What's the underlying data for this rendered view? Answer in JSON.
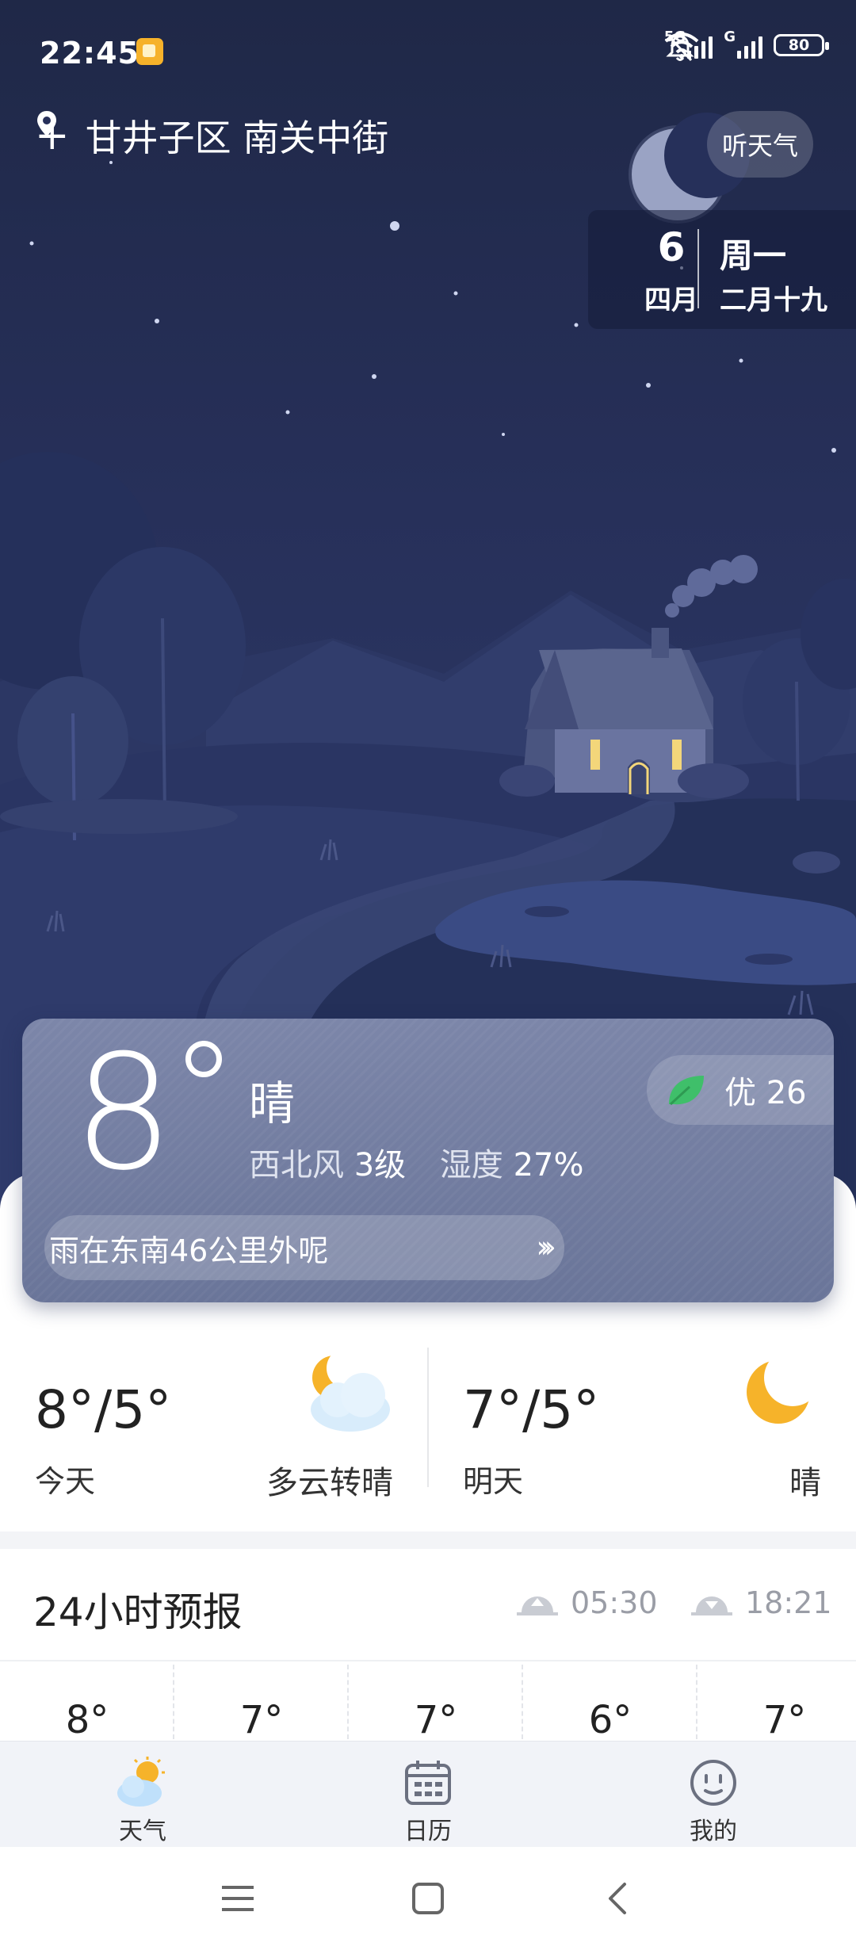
{
  "status_bar": {
    "time": "22:45",
    "network_1": "5G",
    "network_2": "G",
    "battery": "80"
  },
  "header": {
    "location": "甘井子区 南关中街",
    "listen_button": "听天气"
  },
  "date": {
    "day": "6",
    "month": "四月",
    "weekday": "周一",
    "lunar": "二月十九"
  },
  "current": {
    "temperature": "8",
    "condition": "晴",
    "wind_label": "西北风",
    "wind_level": "3级",
    "humidity_label": "湿度",
    "humidity_value": "27%",
    "aqi_label": "优",
    "aqi_value": "26",
    "alert_text": "雨在东南46公里外呢",
    "alert_arrow": "»"
  },
  "daily": [
    {
      "range": "8°/5°",
      "label": "今天",
      "condition": "多云转晴",
      "icon": "partly-cloudy-night-icon"
    },
    {
      "range": "7°/5°",
      "label": "明天",
      "condition": "晴",
      "icon": "moon-icon"
    }
  ],
  "hourly": {
    "title": "24小时预报",
    "sunrise": "05:30",
    "sunset": "18:21",
    "temps": [
      "8°",
      "7°",
      "7°",
      "6°",
      "7°"
    ]
  },
  "tabs": [
    {
      "label": "天气",
      "icon": "weather-icon",
      "active": true
    },
    {
      "label": "日历",
      "icon": "calendar-icon",
      "active": false
    },
    {
      "label": "我的",
      "icon": "profile-icon",
      "active": false
    }
  ],
  "colors": {
    "sky": "#252e57",
    "card": "#737ea1",
    "accent_green": "#3fbf6a",
    "moon": "#f6b32a"
  }
}
